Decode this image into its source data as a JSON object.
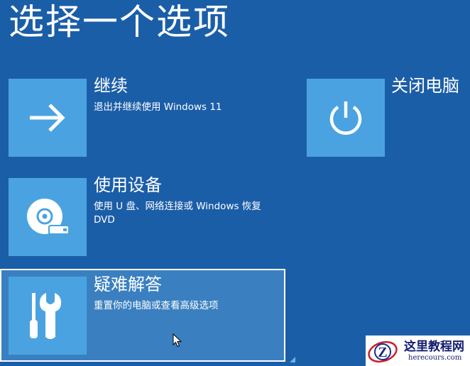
{
  "page": {
    "title": "选择一个选项"
  },
  "options": [
    {
      "title": "继续",
      "description": "退出并继续使用 Windows 11",
      "icon": "arrow-right-icon"
    },
    {
      "title": "使用设备",
      "description": "使用 U 盘、网络连接或 Windows 恢复 DVD",
      "icon": "disc-drive-icon"
    },
    {
      "title": "疑难解答",
      "description": "重置你的电脑或查看高级选项",
      "icon": "tools-icon",
      "selected": true
    },
    {
      "title": "关闭电脑",
      "icon": "power-icon"
    }
  ],
  "watermark": {
    "title": "这里教程网",
    "url": "herecours.com",
    "logo_letter": "Z"
  },
  "colors": {
    "background": "#1b5ea8",
    "tile": "#4aa3e0",
    "selected_row": "#3a80c0",
    "text": "#ffffff"
  }
}
